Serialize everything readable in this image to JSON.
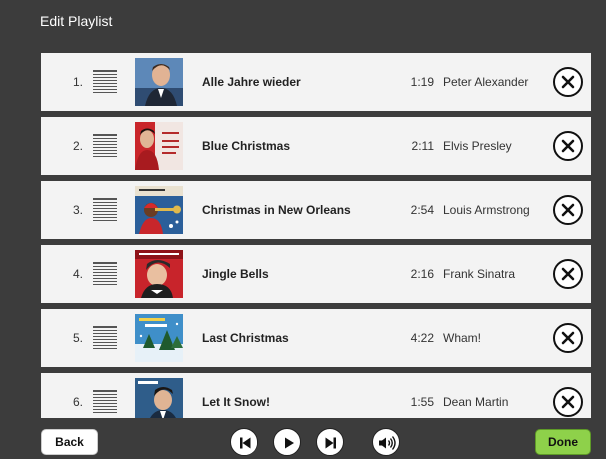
{
  "header": {
    "title": "Edit Playlist"
  },
  "playlist": [
    {
      "num": "1.",
      "title": "Alle Jahre wieder",
      "duration": "1:19",
      "artist": "Peter Alexander",
      "icon": "album-art-peter-alexander"
    },
    {
      "num": "2.",
      "title": "Blue Christmas",
      "duration": "2:11",
      "artist": "Elvis Presley",
      "icon": "album-art-elvis-presley"
    },
    {
      "num": "3.",
      "title": "Christmas in New Orleans",
      "duration": "2:54",
      "artist": "Louis Armstrong",
      "icon": "album-art-louis-armstrong"
    },
    {
      "num": "4.",
      "title": "Jingle Bells",
      "duration": "2:16",
      "artist": "Frank Sinatra",
      "icon": "album-art-frank-sinatra"
    },
    {
      "num": "5.",
      "title": "Last Christmas",
      "duration": "4:22",
      "artist": "Wham!",
      "icon": "album-art-wham"
    },
    {
      "num": "6.",
      "title": "Let It Snow!",
      "duration": "1:55",
      "artist": "Dean Martin",
      "icon": "album-art-dean-martin"
    }
  ],
  "footer": {
    "back_label": "Back",
    "done_label": "Done",
    "controls": [
      "skip-previous-icon",
      "play-icon",
      "skip-next-icon",
      "volume-icon"
    ]
  },
  "colors": {
    "background": "#3c3c3c",
    "row": "#f3f3f3",
    "done_button": "#8ed14a"
  }
}
